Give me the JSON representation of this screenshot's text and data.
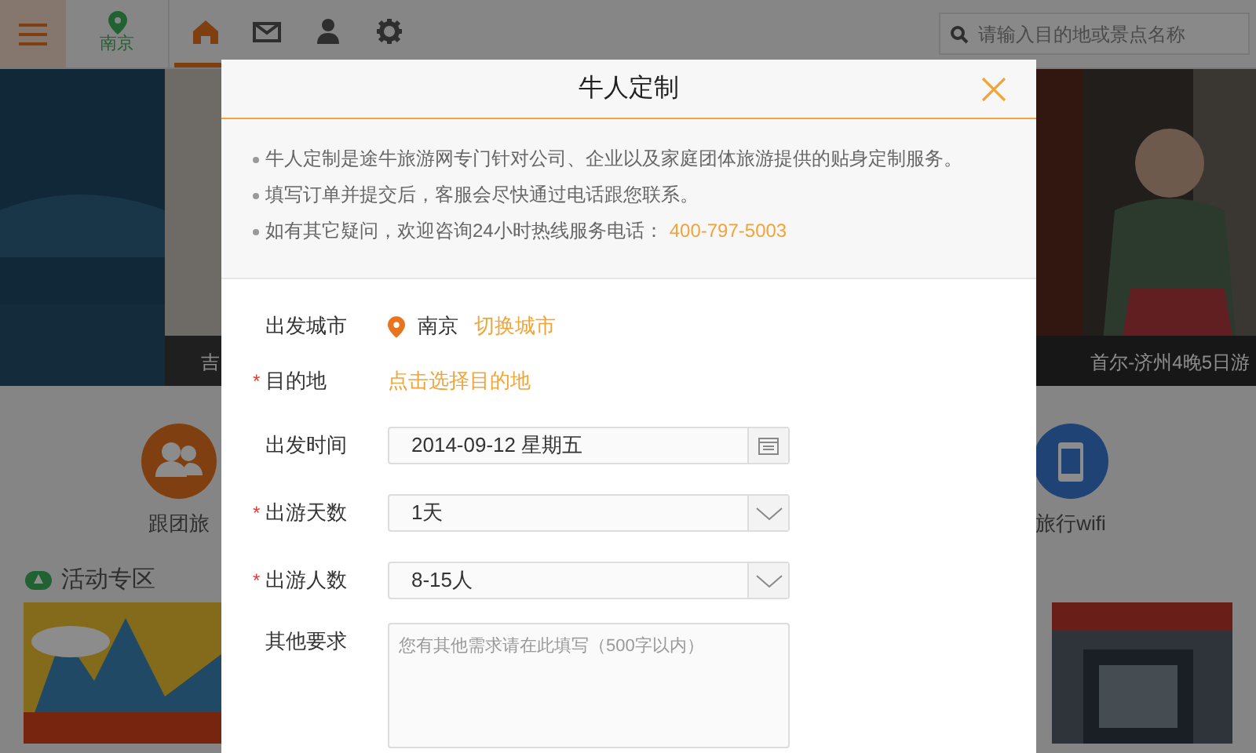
{
  "top_bar": {
    "city": "南京",
    "nav": [
      {
        "selected": true
      },
      {
        "selected": false
      },
      {
        "selected": false
      },
      {
        "selected": false
      }
    ],
    "search": {
      "placeholder": "请输入目的地或景点名称"
    }
  },
  "banners": [
    {
      "caption": "吉"
    },
    {
      "caption": "首尔-济州4晚5日游"
    }
  ],
  "categories": [
    {
      "label": "跟团旅"
    },
    {
      "label": "旅行wifi"
    }
  ],
  "section_title": "活动专区",
  "dialog": {
    "title": "牛人定制",
    "required_mark": "*",
    "info": [
      {
        "text": "牛人定制是途牛旅游网专门针对公司、企业以及家庭团体旅游提供的贴身定制服务。"
      },
      {
        "text": "填写订单并提交后，客服会尽快通过电话跟您联系。"
      },
      {
        "text": "如有其它疑问，欢迎咨询24小时热线服务电话：",
        "phone": "400-797-5003"
      }
    ],
    "fields": [
      {
        "kind": "city",
        "label": "出发城市",
        "required": false,
        "value": "南京",
        "action": "切换城市"
      },
      {
        "kind": "link",
        "label": "目的地",
        "required": true,
        "action": "点击选择目的地"
      },
      {
        "kind": "date",
        "label": "出发时间",
        "required": false,
        "value": "2014-09-12 星期五"
      },
      {
        "kind": "select",
        "label": "出游天数",
        "required": true,
        "value": "1天"
      },
      {
        "kind": "select",
        "label": "出游人数",
        "required": true,
        "value": "8-15人"
      },
      {
        "kind": "textarea",
        "label": "其他要求",
        "required": false,
        "placeholder": "您有其他需求请在此填写（500字以内）"
      }
    ]
  }
}
